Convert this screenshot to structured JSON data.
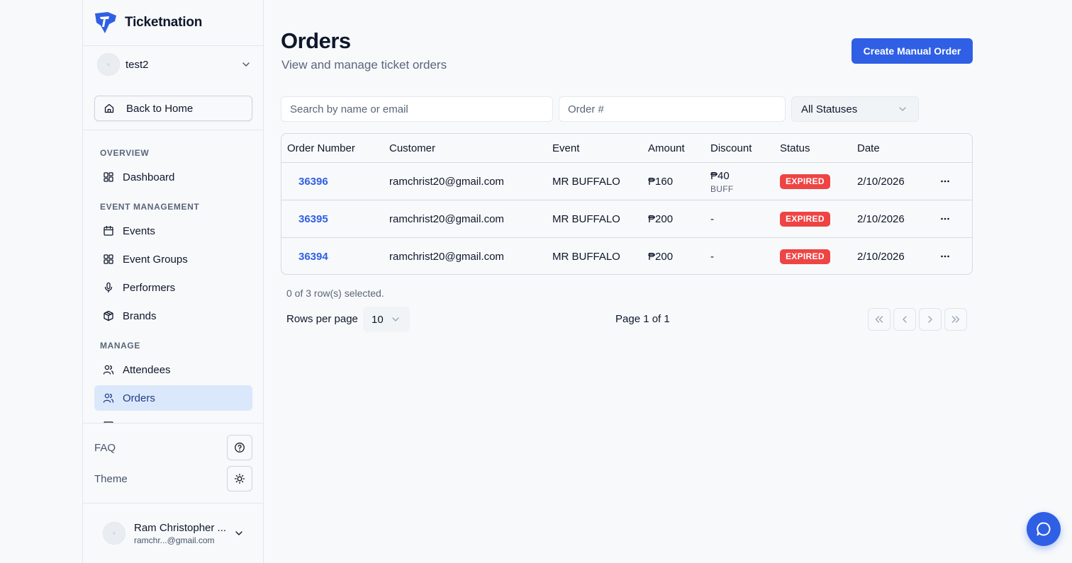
{
  "brand": {
    "name": "Ticketnation",
    "logo_icon": "ticketnation-logo"
  },
  "org_switcher": {
    "name": "test2",
    "icon": "chevron-down-icon"
  },
  "back_button": {
    "label": "Back to Home",
    "icon": "home-icon"
  },
  "sidebar": {
    "sections": [
      {
        "label": "OVERVIEW"
      },
      {
        "label": "EVENT MANAGEMENT"
      },
      {
        "label": "MANAGE"
      }
    ],
    "items": [
      {
        "label": "Dashboard",
        "icon": "dashboard-icon"
      },
      {
        "label": "Events",
        "icon": "calendar-icon"
      },
      {
        "label": "Event Groups",
        "icon": "grid-icon"
      },
      {
        "label": "Performers",
        "icon": "microphone-icon"
      },
      {
        "label": "Brands",
        "icon": "box-icon"
      },
      {
        "label": "Attendees",
        "icon": "users-icon"
      },
      {
        "label": "Orders",
        "icon": "users-icon",
        "active": true
      }
    ],
    "footer": {
      "faq_label": "FAQ",
      "theme_label": "Theme"
    }
  },
  "user": {
    "name": "Ram Christopher ...",
    "email": "ramchr...@gmail.com"
  },
  "header": {
    "title": "Orders",
    "subtitle": "View and manage ticket orders",
    "create_button": "Create Manual Order"
  },
  "filters": {
    "search_placeholder": "Search by name or email",
    "order_placeholder": "Order #",
    "status_value": "All Statuses"
  },
  "table": {
    "columns": [
      "Order Number",
      "Customer",
      "Event",
      "Amount",
      "Discount",
      "Status",
      "Date"
    ],
    "rows": [
      {
        "order": "36396",
        "customer": "ramchrist20@gmail.com",
        "event": "MR BUFFALO",
        "amount": "₱160",
        "discount": "₱40",
        "discount_code": "BUFF",
        "status": "EXPIRED",
        "date": "2/10/2026"
      },
      {
        "order": "36395",
        "customer": "ramchrist20@gmail.com",
        "event": "MR BUFFALO",
        "amount": "₱200",
        "discount": "-",
        "discount_code": "",
        "status": "EXPIRED",
        "date": "2/10/2026"
      },
      {
        "order": "36394",
        "customer": "ramchrist20@gmail.com",
        "event": "MR BUFFALO",
        "amount": "₱200",
        "discount": "-",
        "discount_code": "",
        "status": "EXPIRED",
        "date": "2/10/2026"
      }
    ]
  },
  "pagination": {
    "selection_text": "0 of 3 row(s) selected.",
    "rows_per_page_label": "Rows per page",
    "rows_per_page_value": "10",
    "page_text": "Page 1 of 1"
  },
  "colors": {
    "accent": "#2f5fe4",
    "expired": "#ef4444",
    "active_nav": "#dbe8fb"
  }
}
